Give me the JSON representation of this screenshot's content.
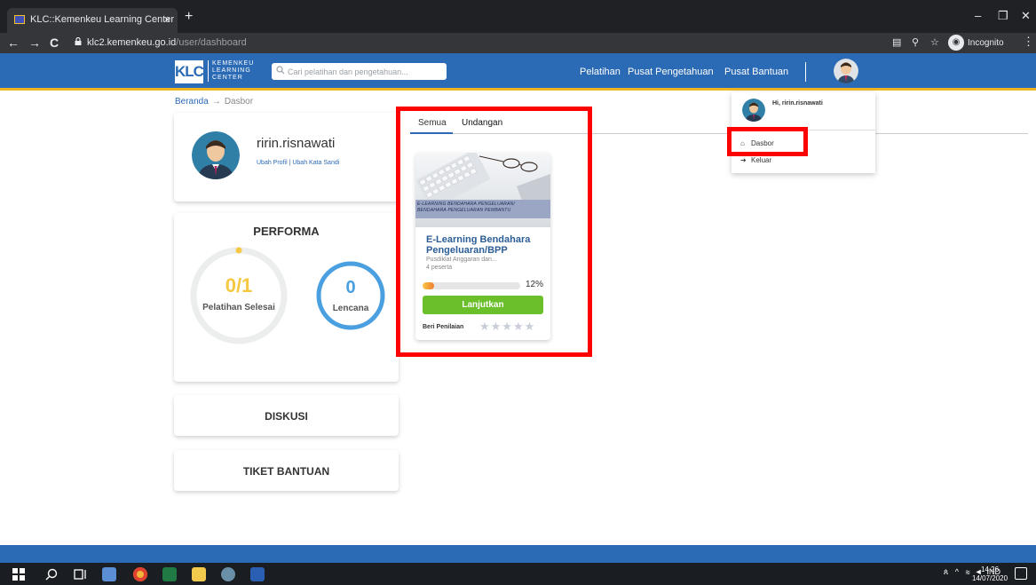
{
  "browser": {
    "tab_title": "KLC::Kemenkeu Learning Center",
    "tab_close": "×",
    "new_tab": "+",
    "url_host": "klc2.kemenkeu.go.id",
    "url_path": "/user/dashboard",
    "incognito_label": "Incognito",
    "minimize": "–",
    "restore": "❐",
    "close": "✕",
    "back": "←",
    "forward": "→",
    "reload": "C",
    "menu": "⋮"
  },
  "header": {
    "logo_mark": "KLC",
    "logo_lines": [
      "KEMENKEU",
      "LEARNING",
      "CENTER"
    ],
    "search_placeholder": "Cari pelatihan dan pengetahuan...",
    "nav": [
      "Pelatihan",
      "Pusat Pengetahuan",
      "Pusat Bantuan"
    ]
  },
  "breadcrumb": {
    "home": "Beranda",
    "separator": "→",
    "current": "Dasbor"
  },
  "profile": {
    "username": "ririn.risnawati",
    "edit_profile": "Ubah Profil",
    "link_sep": " | ",
    "change_password": "Ubah Kata Sandi"
  },
  "performa": {
    "title": "PERFORMA",
    "completed_value": "0/1",
    "completed_label": "Pelatihan Selesai",
    "badge_value": "0",
    "badge_label": "Lencana",
    "completed_color": "#f5c842",
    "badge_color": "#4a9fe0"
  },
  "sections": {
    "diskusi": "DISKUSI",
    "tiket": "TIKET BANTUAN"
  },
  "tabs": {
    "all": "Semua",
    "invitation": "Undangan"
  },
  "course": {
    "banner_line1": "E-LEARNING BENDAHARA PENGELUARAN/",
    "banner_line2": "BENDAHARA PENGELUARAN PEMBANTU",
    "title": "E-Learning Bendahara Pengeluaran/BPP",
    "provider": "Pusdiklat Anggaran dan...",
    "participants": "4 peserta",
    "progress": 0.12,
    "progress_label": "12%",
    "continue_label": "Lanjutkan",
    "rate_label": "Beri Penilaian",
    "stars": "★★★★★"
  },
  "dropdown": {
    "greeting": "Hi, ririn.risnawati",
    "items": [
      "Dasbor",
      "Keluar"
    ]
  },
  "taskbar": {
    "ime": "IND",
    "time": "14.26",
    "date": "14/07/2020"
  },
  "colors": {
    "brand_blue": "#2b6bb5",
    "accent_yellow": "#f0b323",
    "highlight_red": "#ff0000",
    "button_green": "#6bbf2b"
  }
}
